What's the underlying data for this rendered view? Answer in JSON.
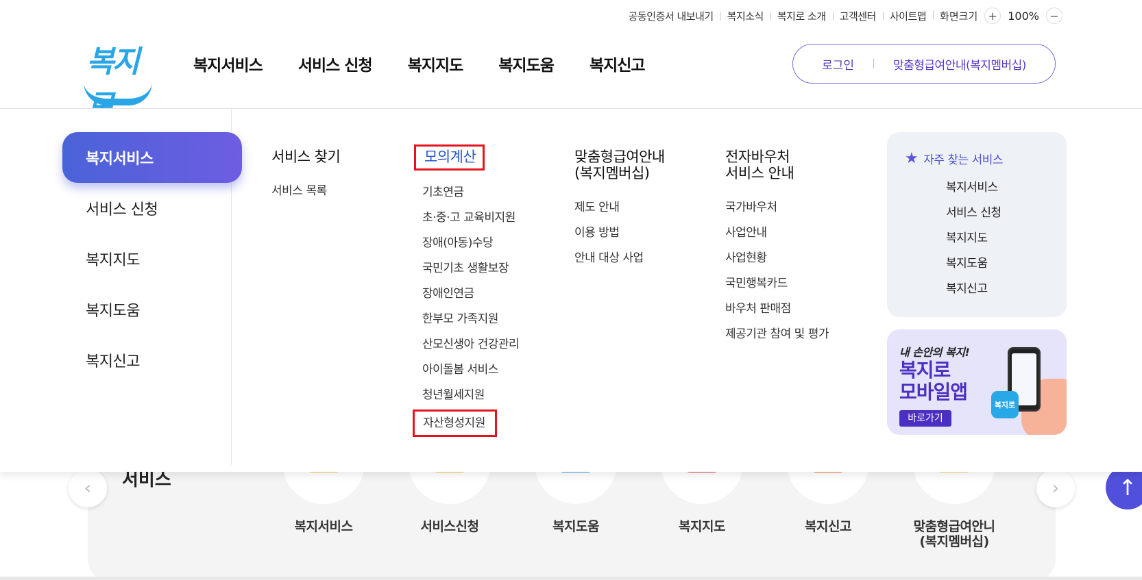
{
  "utility": {
    "links": [
      "공동인증서 내보내기",
      "복지소식",
      "복지로 소개",
      "고객센터",
      "사이트맵"
    ],
    "zoom_label": "화면크기",
    "zoom_plus": "+",
    "zoom_value": "100%",
    "zoom_minus": "−"
  },
  "logo": {
    "text": "복지로"
  },
  "gnb": [
    "복지서비스",
    "서비스 신청",
    "복지지도",
    "복지도움",
    "복지신고"
  ],
  "login": {
    "login_label": "로그인",
    "member_label": "맞춤형급여안내(복지멤버십)"
  },
  "side_menu": [
    {
      "label": "복지서비스",
      "active": true
    },
    {
      "label": "서비스 신청"
    },
    {
      "label": "복지지도"
    },
    {
      "label": "복지도움"
    },
    {
      "label": "복지신고"
    }
  ],
  "columns": [
    {
      "title": "서비스 찾기",
      "items": [
        "서비스 목록"
      ]
    },
    {
      "title": "모의계산",
      "items": [
        "기초연금",
        "초·중·고 교육비지원",
        "장애(아동)수당",
        "국민기초 생활보장",
        "장애인연금",
        "한부모 가족지원",
        "산모신생아 건강관리",
        "아이돌봄 서비스",
        "청년월세지원",
        "자산형성지원"
      ]
    },
    {
      "title_line1": "맞춤형급여안내",
      "title_line2": "(복지멤버십)",
      "items": [
        "제도 안내",
        "이용 방법",
        "안내 대상 사업"
      ]
    },
    {
      "title_line1": "전자바우처",
      "title_line2": "서비스 안내",
      "items": [
        "국가바우처",
        "사업안내",
        "사업현황",
        "국민행복카드",
        "바우처 판매점",
        "제공기관 참여 및 평가"
      ]
    }
  ],
  "favorites": {
    "title": "자주 찾는 서비스",
    "items": [
      "복지서비스",
      "서비스 신청",
      "복지지도",
      "복지도움",
      "복지신고"
    ]
  },
  "app_banner": {
    "small": "내 손안의 복지!",
    "big1": "복지로",
    "big2": "모바일앱",
    "button": "바로가기",
    "icon_text": "복지로"
  },
  "under": {
    "title": "서비스",
    "prev": "‹",
    "next": "›",
    "top": "↑",
    "items": [
      {
        "label": "복지서비스",
        "color": "#f2c94c"
      },
      {
        "label": "서비스신청",
        "color": "#f5c542"
      },
      {
        "label": "복지도움",
        "color": "#3aa0e8"
      },
      {
        "label": "복지지도",
        "color": "#e84545"
      },
      {
        "label": "복지신고",
        "color": "#f07a2a"
      },
      {
        "label_line1": "맞춤형급여안니",
        "label_line2": "(복지멤버십)",
        "color": "#f2d06b"
      }
    ]
  },
  "colors": {
    "accent": "#5a4fd8",
    "highlight_box": "#e3141d",
    "logo_blue": "#2aa6e6"
  }
}
